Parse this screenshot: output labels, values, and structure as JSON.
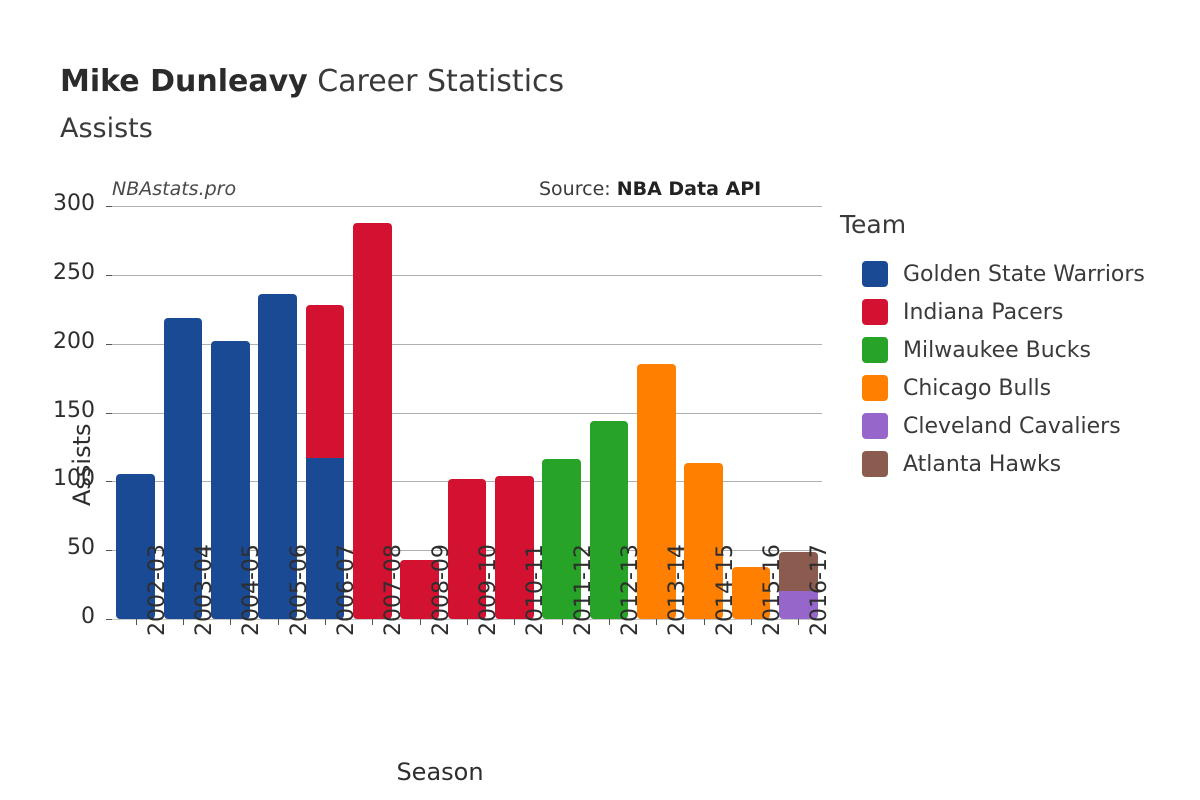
{
  "header": {
    "title_strong": "Mike Dunleavy",
    "title_rest": " Career Statistics",
    "subtitle": "Assists"
  },
  "annotations": {
    "watermark": "NBAstats.pro",
    "source_label": "Source: ",
    "source_value": "NBA Data API"
  },
  "legend": {
    "title": "Team",
    "items": [
      {
        "label": "Golden State Warriors",
        "color": "#1b4a95"
      },
      {
        "label": "Indiana Pacers",
        "color": "#d31231"
      },
      {
        "label": "Milwaukee Bucks",
        "color": "#27a327"
      },
      {
        "label": "Chicago Bulls",
        "color": "#ff8000"
      },
      {
        "label": "Cleveland Cavaliers",
        "color": "#9766cb"
      },
      {
        "label": "Atlanta Hawks",
        "color": "#8b5b4f"
      }
    ]
  },
  "chart_data": {
    "type": "bar",
    "stacked": true,
    "title": "Mike Dunleavy Career Statistics",
    "subtitle": "Assists",
    "xlabel": "Season",
    "ylabel": "Assists",
    "ylim": [
      0,
      300
    ],
    "yticks": [
      0,
      50,
      100,
      150,
      200,
      250,
      300
    ],
    "ytick_labels": [
      "0",
      "50",
      "100",
      "150",
      "200",
      "250",
      "300"
    ],
    "grid": "horizontal",
    "legend_position": "right",
    "categories": [
      "2002-03",
      "2003-04",
      "2004-05",
      "2005-06",
      "2006-07",
      "2007-08",
      "2008-09",
      "2009-10",
      "2010-11",
      "2011-12",
      "2012-13",
      "2013-14",
      "2014-15",
      "2015-16",
      "2016-17"
    ],
    "series": [
      {
        "name": "Golden State Warriors",
        "color": "#1b4a95",
        "values": [
          105,
          219,
          202,
          236,
          117,
          0,
          0,
          0,
          0,
          0,
          0,
          0,
          0,
          0,
          0
        ]
      },
      {
        "name": "Indiana Pacers",
        "color": "#d31231",
        "values": [
          0,
          0,
          0,
          0,
          111,
          288,
          43,
          102,
          104,
          0,
          0,
          0,
          0,
          0,
          0
        ]
      },
      {
        "name": "Milwaukee Bucks",
        "color": "#27a327",
        "values": [
          0,
          0,
          0,
          0,
          0,
          0,
          0,
          0,
          0,
          116,
          144,
          0,
          0,
          0,
          0
        ]
      },
      {
        "name": "Chicago Bulls",
        "color": "#ff8000",
        "values": [
          0,
          0,
          0,
          0,
          0,
          0,
          0,
          0,
          0,
          0,
          0,
          185,
          113,
          38,
          0
        ]
      },
      {
        "name": "Cleveland Cavaliers",
        "color": "#9766cb",
        "values": [
          0,
          0,
          0,
          0,
          0,
          0,
          0,
          0,
          0,
          0,
          0,
          0,
          0,
          0,
          20
        ]
      },
      {
        "name": "Atlanta Hawks",
        "color": "#8b5b4f",
        "values": [
          0,
          0,
          0,
          0,
          0,
          0,
          0,
          0,
          0,
          0,
          0,
          0,
          0,
          0,
          29
        ]
      }
    ],
    "totals": [
      105,
      219,
      202,
      236,
      228,
      288,
      43,
      102,
      104,
      116,
      144,
      185,
      113,
      38,
      49
    ]
  }
}
